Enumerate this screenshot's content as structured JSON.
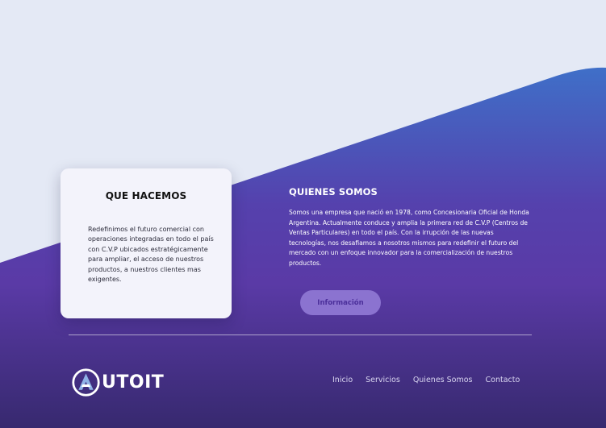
{
  "what_we_do": {
    "title": "QUE HACEMOS",
    "text": "Redefinimos el futuro comercial con operaciones integradas en todo el país con C.V.P ubicados estratégicamente para ampliar, el acceso de nuestros productos, a nuestros clientes mas exigentes."
  },
  "about": {
    "title": "QUIENES SOMOS",
    "text": "Somos una empresa que nació en 1978, como Concesionaria Oficial de Honda Argentina. Actualmente conduce y amplia la primera red de C.V.P (Centros de Ventas Particulares) en todo el país. Con la irrupción de las nuevas tecnologías, nos desafiamos a nosotros mismos para redefinir el futuro del mercado con un enfoque innovador para la comercialización de nuestros productos.",
    "button_label": "Información"
  },
  "footer": {
    "logo_text": "UTOIT",
    "nav": [
      "Inicio",
      "Servicios",
      "Quienes Somos",
      "Contacto"
    ]
  },
  "colors": {
    "background_light": "#e4e9f5",
    "gradient_top": "#3f6ec6",
    "gradient_mid": "#5b3aa8",
    "gradient_bottom": "#3a2b7a",
    "button": "#8b73d0"
  }
}
